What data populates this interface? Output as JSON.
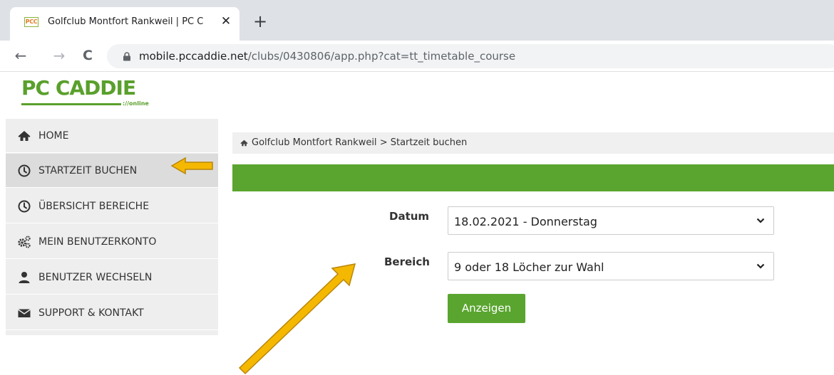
{
  "browser": {
    "tab_favicon": "PCC",
    "tab_title": "Golfclub Montfort Rankweil | PC C",
    "tab_close": "✕",
    "new_tab": "+",
    "back": "←",
    "forward": "→",
    "reload": "C",
    "url_domain": "mobile.pccaddie.net",
    "url_path": "/clubs/0430806/app.php?cat=tt_timetable_course"
  },
  "logo": {
    "text": "PC CADDIE",
    "sub": "://online"
  },
  "sidebar": {
    "items": [
      {
        "label": "HOME",
        "icon": "home-icon"
      },
      {
        "label": "STARTZEIT BUCHEN",
        "icon": "clock-icon",
        "active": true
      },
      {
        "label": "ÜBERSICHT BEREICHE",
        "icon": "clock-icon"
      },
      {
        "label": "MEIN BENUTZERKONTO",
        "icon": "gears-icon"
      },
      {
        "label": "BENUTZER WECHSELN",
        "icon": "user-icon"
      },
      {
        "label": "SUPPORT & KONTAKT",
        "icon": "envelope-icon"
      }
    ]
  },
  "breadcrumb": {
    "club": "Golfclub Montfort Rankweil",
    "separator": ">",
    "page": "Startzeit buchen"
  },
  "form": {
    "date_label": "Datum",
    "date_value": "18.02.2021 - Donnerstag",
    "area_label": "Bereich",
    "area_value": "9 oder 18 Löcher zur Wahl",
    "submit_label": "Anzeigen"
  },
  "colors": {
    "brand_green": "#5aa52f",
    "annotation_arrow": "#f5b800"
  }
}
